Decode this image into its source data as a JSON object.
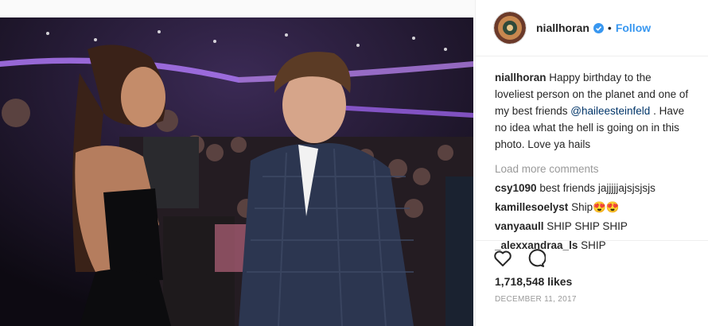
{
  "post": {
    "username": "niallhoran",
    "follow_label": "Follow",
    "separator": "•",
    "caption": {
      "user": "niallhoran",
      "text_before": " Happy birthday to the loveliest person on the planet and one of my best friends ",
      "mention": "@haileesteinfeld",
      "text_after": " . Have no idea what the hell is going on in this photo. Love ya hails"
    },
    "load_more": "Load more comments",
    "comments": [
      {
        "user": "csy1090",
        "text": " best friends jajjjjjajsjsjsjs"
      },
      {
        "user": "kamillesoelyst",
        "text": " Ship😍😍"
      },
      {
        "user": "vanyaaull",
        "text": " SHIP SHIP SHIP"
      },
      {
        "user": "_alexxandraa_ls",
        "text": " SHIP"
      }
    ],
    "likes": "1,718,548 likes",
    "date": "DECEMBER 11, 2017"
  },
  "icons": {
    "verified": "verified-badge-icon",
    "like": "heart-icon",
    "comment": "comment-bubble-icon"
  },
  "colors": {
    "accent": "#3897f0",
    "mention": "#003569",
    "muted": "#999999"
  }
}
